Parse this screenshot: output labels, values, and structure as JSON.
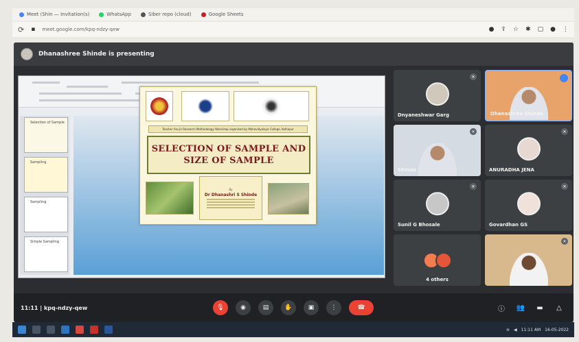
{
  "browser": {
    "bookmarks": [
      {
        "label": "Meet (Shin — Invitation(s)",
        "color": "#4285f4"
      },
      {
        "label": "WhatsApp",
        "color": "#25d366"
      },
      {
        "label": "Siber repo (cloud)",
        "color": "#555555"
      },
      {
        "label": "Google Sheets",
        "color": "#c5221f"
      }
    ],
    "url": "meet.google.com/kpq-ndzy-qew"
  },
  "meet": {
    "presenting_text": "Dhanashree Shinde is presenting",
    "meeting_code": "11:11  |  kpq-ndzy-qew",
    "participants": [
      {
        "name": "Dnyaneshwar Garg",
        "type": "avatar",
        "color": "#cfc8bb"
      },
      {
        "name": "Dhanashree Shinde",
        "type": "video",
        "color": "#e8a36a"
      },
      {
        "name": "Shinde",
        "type": "video",
        "color": "#d5dbe3"
      },
      {
        "name": "ANURADHA JENA",
        "type": "avatar",
        "color": "#e7d9d2"
      },
      {
        "name": "Sunil G Bhosale",
        "type": "avatar",
        "color": "#c7c7c7"
      },
      {
        "name": "Govardhan GS",
        "type": "avatar",
        "color": "#f0e2da"
      },
      {
        "name": "4 others",
        "type": "others",
        "color": "#f47c4e"
      },
      {
        "name": "",
        "type": "video",
        "color": "#d7b98d"
      }
    ],
    "controls": [
      "mic",
      "camera",
      "captions",
      "raise-hand",
      "present",
      "more",
      "end-call"
    ],
    "right_controls": [
      "info",
      "people",
      "chat",
      "activities"
    ]
  },
  "slide": {
    "banner": "Teacher Anuj's Research Methodology Workshop organized by Mahavidyalaya College, Kolhapur",
    "title_line1": "SELECTION OF SAMPLE AND",
    "title_line2": "SIZE OF SAMPLE",
    "speaker_by": "By",
    "speaker_name": "Dr Dhanashri S Shinde",
    "thumb_labels": [
      "Selection of Sample",
      "Sampling",
      "Sampling",
      "Simple Sampling"
    ]
  },
  "taskbar": {
    "time": "11:11 AM",
    "date": "16-05-2022"
  }
}
